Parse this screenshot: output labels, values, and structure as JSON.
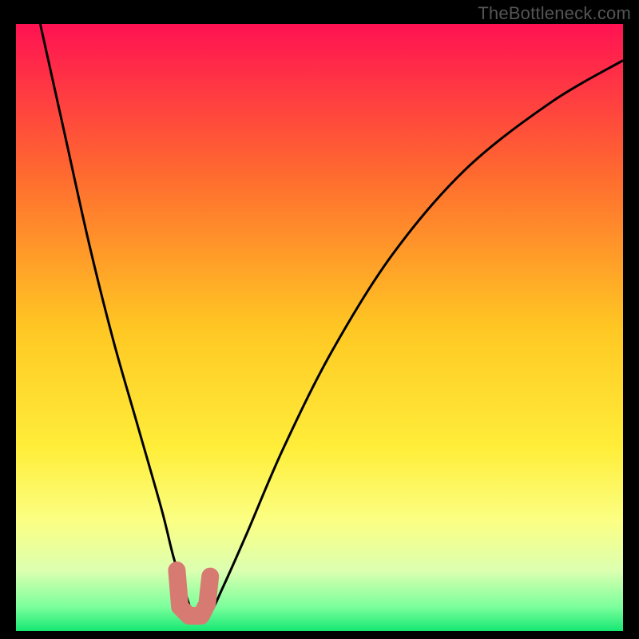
{
  "attribution": "TheBottleneck.com",
  "chart_data": {
    "type": "line",
    "title": "",
    "xlabel": "",
    "ylabel": "",
    "xlim": [
      0,
      100
    ],
    "ylim": [
      0,
      100
    ],
    "grid": false,
    "background_gradient": {
      "stops": [
        {
          "offset": 0,
          "color": "#ff1252"
        },
        {
          "offset": 25,
          "color": "#ff6b2f"
        },
        {
          "offset": 50,
          "color": "#ffc723"
        },
        {
          "offset": 70,
          "color": "#ffee3a"
        },
        {
          "offset": 82,
          "color": "#fbff84"
        },
        {
          "offset": 90,
          "color": "#dcffb0"
        },
        {
          "offset": 96,
          "color": "#7cff9c"
        },
        {
          "offset": 100,
          "color": "#15e873"
        }
      ]
    },
    "series": [
      {
        "name": "bottleneck-curve",
        "color": "#000000",
        "x": [
          4,
          8,
          12,
          16,
          20,
          24,
          26,
          28,
          29,
          30,
          32,
          34,
          38,
          44,
          52,
          62,
          74,
          88,
          100
        ],
        "y": [
          100,
          82,
          64,
          48,
          34,
          20,
          12,
          6,
          3,
          2,
          3,
          7,
          16,
          30,
          46,
          62,
          76,
          87,
          94
        ]
      }
    ],
    "marker": {
      "name": "optimal-range",
      "color": "#d77a72",
      "x": [
        26.5,
        27,
        28.5,
        30.5,
        31.5,
        32
      ],
      "y": [
        10,
        4,
        2.5,
        2.5,
        4.5,
        9
      ]
    }
  }
}
